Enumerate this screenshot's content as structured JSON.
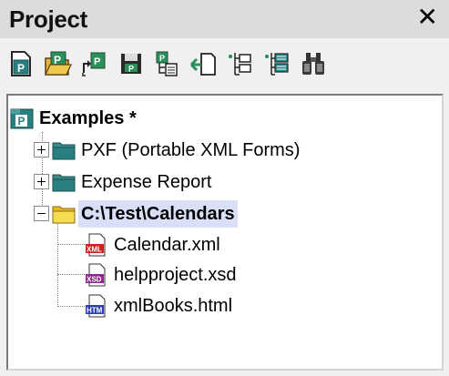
{
  "panel": {
    "title": "Project",
    "close_glyph": "✕"
  },
  "toolbar": {
    "buttons": [
      {
        "name": "new-project",
        "icon": "new-project-icon"
      },
      {
        "name": "open-project",
        "icon": "open-project-icon"
      },
      {
        "name": "reload-project",
        "icon": "reload-project-icon"
      },
      {
        "name": "save-project",
        "icon": "save-project-icon"
      },
      {
        "name": "add-files",
        "icon": "add-files-icon"
      },
      {
        "name": "add-active-file",
        "icon": "add-active-file-icon"
      },
      {
        "name": "add-folder",
        "icon": "add-folder-icon"
      },
      {
        "name": "add-external-folder",
        "icon": "add-external-folder-icon"
      },
      {
        "name": "find",
        "icon": "binoculars-icon"
      }
    ]
  },
  "tree": {
    "root": {
      "label": "Examples *",
      "icon": "project-icon",
      "expanded": true
    },
    "folders": [
      {
        "label": "PXF (Portable XML Forms)",
        "expanded": false,
        "icon": "teal-folder-icon"
      },
      {
        "label": "Expense Report",
        "expanded": false,
        "icon": "teal-folder-icon"
      },
      {
        "label": "C:\\Test\\Calendars",
        "expanded": true,
        "icon": "yellow-folder-icon",
        "selected": true
      }
    ],
    "files": [
      {
        "label": "Calendar.xml",
        "badge": "XML",
        "badge_color": "#cc2222"
      },
      {
        "label": "helpproject.xsd",
        "badge": "XSD",
        "badge_color": "#8a2a8a"
      },
      {
        "label": "xmlBooks.html",
        "badge": "HTM",
        "badge_color": "#2a3fb0"
      }
    ]
  },
  "colors": {
    "teal": "#2a7f80",
    "green": "#2c8f2c",
    "yellow_folder": "#f4d63a",
    "selection": "#d8dff7"
  }
}
